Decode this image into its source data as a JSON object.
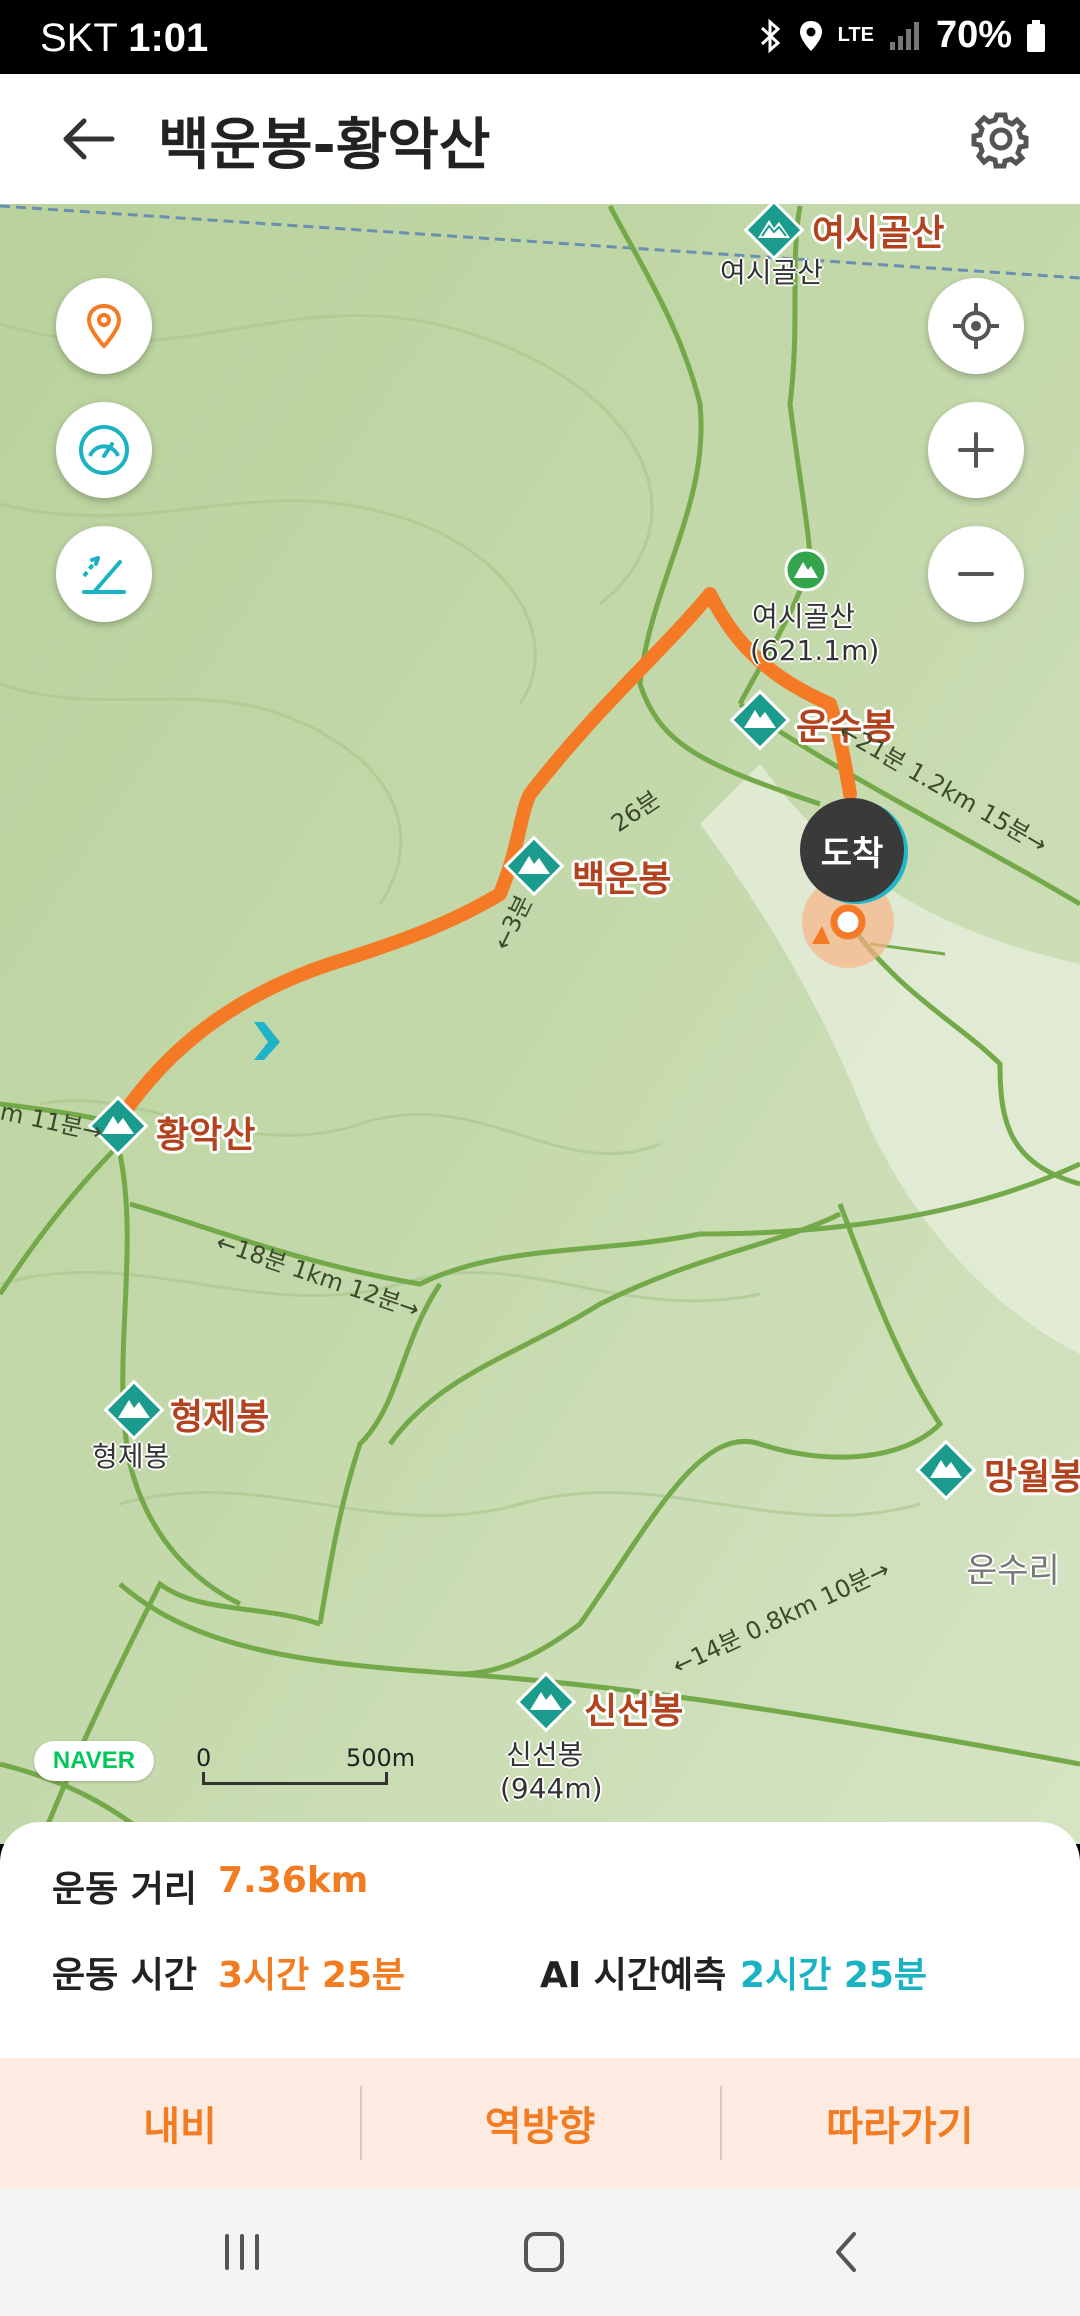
{
  "status_bar": {
    "carrier": "SKT",
    "time": "1:01",
    "network": "LTE",
    "battery": "70%"
  },
  "header": {
    "title": "백운봉-황악산",
    "icons": [
      "back-arrow-icon",
      "gear-icon"
    ]
  },
  "map": {
    "controls_left": [
      "location-pin-icon",
      "speedometer-icon",
      "slope-measure-icon"
    ],
    "controls_right": [
      "current-location-icon",
      "zoom-in-icon",
      "zoom-out-icon"
    ],
    "peaks": [
      {
        "name": "여시골산",
        "sub": "여시골산"
      },
      {
        "name": "운수봉",
        "sub": ""
      },
      {
        "name": "백운봉",
        "sub": ""
      },
      {
        "name": "황악산",
        "sub": ""
      },
      {
        "name": "형제봉",
        "sub": "형제봉"
      },
      {
        "name": "망월봉",
        "sub": ""
      },
      {
        "name": "신선봉",
        "sub": "신선봉"
      }
    ],
    "summits": [
      {
        "name": "여시골산",
        "elevation": "(621.1m)"
      },
      {
        "name": "신선봉",
        "elevation": "(944m)"
      }
    ],
    "place_label": "운수리",
    "trail_labels": [
      "←21분 1.2km 15분→",
      "←18분 1km 12분→",
      "←14분 0.8km 10분→",
      "m 11분→",
      "←3분",
      "26분"
    ],
    "arrival_badge": "도착",
    "provider_logo": "NAVER",
    "scale": {
      "start": "0",
      "end": "500m"
    },
    "colors": {
      "route": "#f57a25",
      "trail": "#74a94a",
      "peak_marker": "#1b9b8c"
    }
  },
  "stats": {
    "distance_label": "운동 거리",
    "distance_value": "7.36km",
    "time_label": "운동 시간",
    "time_value": "3시간 25분",
    "ai_label": "AI 시간예측",
    "ai_value": "2시간 25분"
  },
  "actions": {
    "navigate": "내비",
    "reverse": "역방향",
    "follow": "따라가기"
  },
  "nav_bar": {
    "icons": [
      "recent-apps-icon",
      "home-icon",
      "back-icon"
    ]
  }
}
